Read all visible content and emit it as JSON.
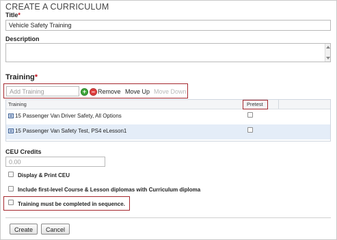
{
  "page": {
    "title": "CREATE A CURRICULUM"
  },
  "title_field": {
    "label": "Title",
    "required_mark": "*",
    "value": "Vehicle Safety Training"
  },
  "description_field": {
    "label": "Description",
    "value": ""
  },
  "training": {
    "label": "Training",
    "required_mark": "*",
    "add_placeholder": "Add Training",
    "add_icon": "plus-icon",
    "remove_icon": "minus-icon",
    "remove_label": "Remove",
    "move_up_label": "Move Up",
    "move_down_label": "Move Down",
    "columns": [
      "Training",
      "Pretest"
    ],
    "rows": [
      {
        "name": "15 Passenger Van Driver Safety, All Options",
        "icon": "lesson-icon",
        "pretest": false
      },
      {
        "name": "15 Passenger Van Safety Test, PS4 eLesson1",
        "icon": "lesson-icon",
        "pretest": false
      }
    ]
  },
  "ceu": {
    "label": "CEU Credits",
    "placeholder": "0.00"
  },
  "options": {
    "display_print_ceu": "Display & Print CEU",
    "include_diplomas": "Include first-level Course & Lesson diplomas with Curriculum diploma",
    "sequence": "Training must be completed in sequence."
  },
  "actions": {
    "create": "Create",
    "cancel": "Cancel"
  },
  "colors": {
    "highlight_box": "#a4262c",
    "required": "#c0121e",
    "selected_row": "#e4edf8"
  }
}
